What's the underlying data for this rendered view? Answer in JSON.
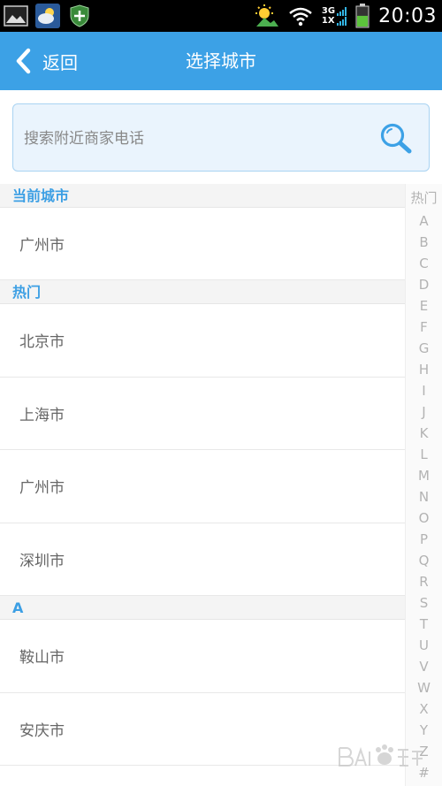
{
  "status_bar": {
    "time": "20:03",
    "network_top": "3G",
    "network_bottom": "1X",
    "icons": [
      "gallery-icon",
      "weather-icon",
      "shield-plus-icon",
      "weather-sun-icon",
      "wifi-icon",
      "signal-icon",
      "battery-icon"
    ],
    "battery_level": 0.55,
    "accent_color": "#33b5e5"
  },
  "titlebar": {
    "back_label": "返回",
    "title": "选择城市",
    "background_color": "#3ca1e6"
  },
  "search": {
    "placeholder": "搜索附近商家电话",
    "value": ""
  },
  "sections": {
    "current": {
      "header": "当前城市",
      "items": [
        "广州市"
      ]
    },
    "hot": {
      "header": "热门",
      "items": [
        "北京市",
        "上海市",
        "广州市",
        "深圳市"
      ]
    },
    "a": {
      "header": "A",
      "items": [
        "鞍山市",
        "安庆市"
      ]
    }
  },
  "index_bar": {
    "items": [
      "热门",
      "A",
      "B",
      "C",
      "D",
      "E",
      "F",
      "G",
      "H",
      "I",
      "J",
      "K",
      "L",
      "M",
      "N",
      "O",
      "P",
      "Q",
      "R",
      "S",
      "T",
      "U",
      "V",
      "W",
      "X",
      "Y",
      "Z",
      "#"
    ]
  }
}
